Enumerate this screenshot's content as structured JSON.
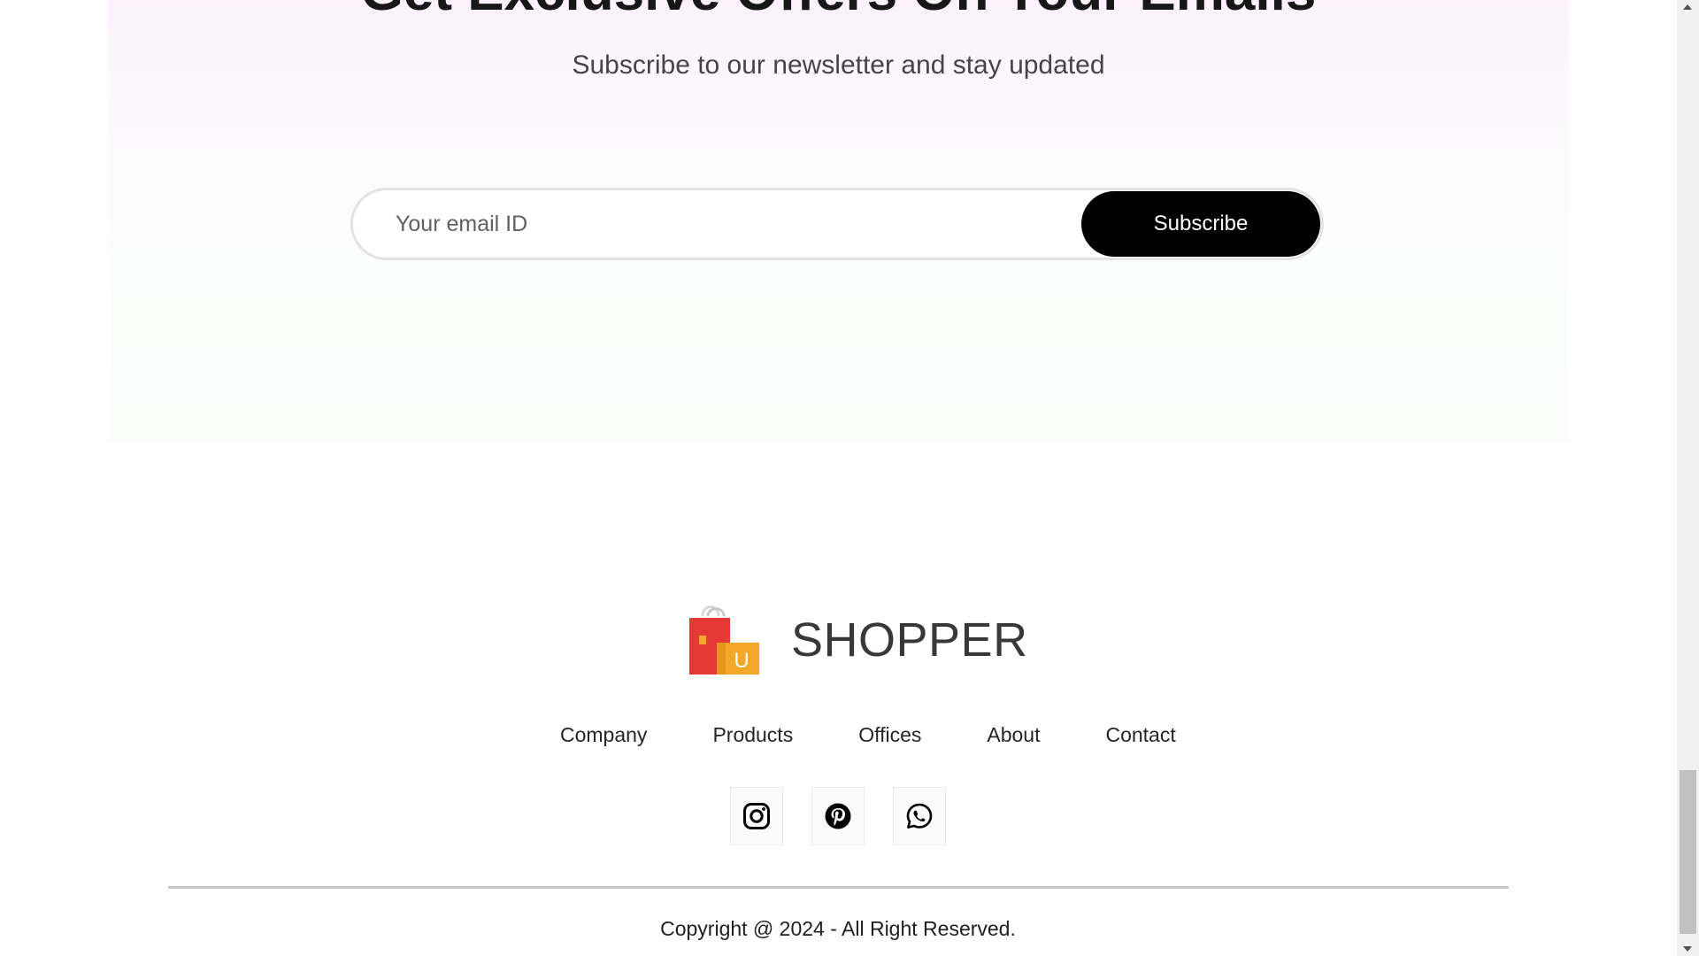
{
  "newsletter": {
    "title": "Get Exclusive Offers On Your Emails",
    "subtitle": "Subscribe to our newsletter and stay updated",
    "email_placeholder": "Your email ID",
    "email_value": "",
    "subscribe_label": "Subscribe"
  },
  "footer": {
    "brand": "SHOPPER",
    "logo_letter": "U",
    "links": [
      "Company",
      "Products",
      "Offices",
      "About",
      "Contact"
    ],
    "social": [
      {
        "name": "instagram-icon"
      },
      {
        "name": "pinterest-icon"
      },
      {
        "name": "whatsapp-icon"
      }
    ],
    "copyright": "Copyright @ 2024 - All Right Reserved."
  },
  "colors": {
    "button_bg": "#000000",
    "button_text": "#ffffff",
    "logo_bag_red": "#e53935",
    "logo_bag_orange": "#f4a82a"
  }
}
